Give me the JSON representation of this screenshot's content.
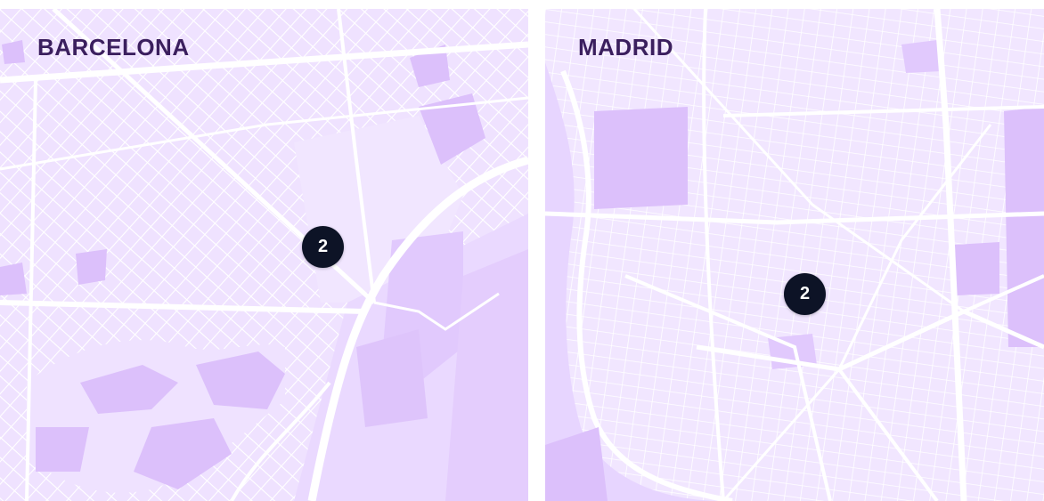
{
  "colors": {
    "map_background": "#f3e9ff",
    "block_fill": "#e9d8ff",
    "park_fill": "#dcc0fb",
    "road": "#ffffff",
    "label_text": "#3b1f5e",
    "marker_fill": "#0d1326",
    "marker_text": "#ffffff"
  },
  "maps": [
    {
      "city": "BARCELONA",
      "cluster_count": "2",
      "marker_icon": "cluster-marker"
    },
    {
      "city": "MADRID",
      "cluster_count": "2",
      "marker_icon": "cluster-marker"
    }
  ]
}
